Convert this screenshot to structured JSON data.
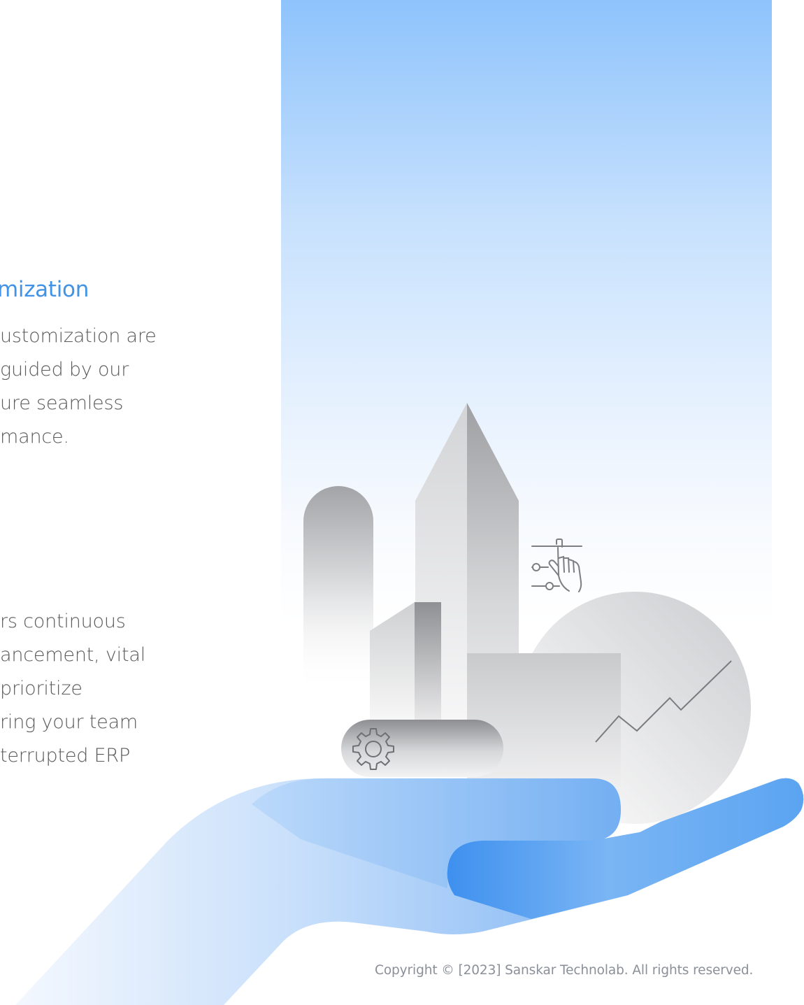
{
  "section_one": {
    "heading": "mization",
    "lines": [
      "ustomization are",
      "guided by our",
      "ure seamless",
      "mance."
    ]
  },
  "section_two": {
    "lines": [
      "rs continuous",
      "ancement, vital",
      " prioritize",
      "ring your team",
      "terrupted ERP"
    ]
  },
  "footer": {
    "copyright": "Copyright © [2023] Sanskar Technolab. All rights reserved."
  },
  "illustration": {
    "icons": [
      "gear-icon",
      "touch-settings-icon",
      "growth-line-icon"
    ],
    "colors": {
      "accent": "#4293e6",
      "sky_top": "#8ec3fc",
      "hand_light": "#e8f2fd",
      "hand_dark": "#3f97f2",
      "building_gray": "#a8a9ac"
    }
  }
}
